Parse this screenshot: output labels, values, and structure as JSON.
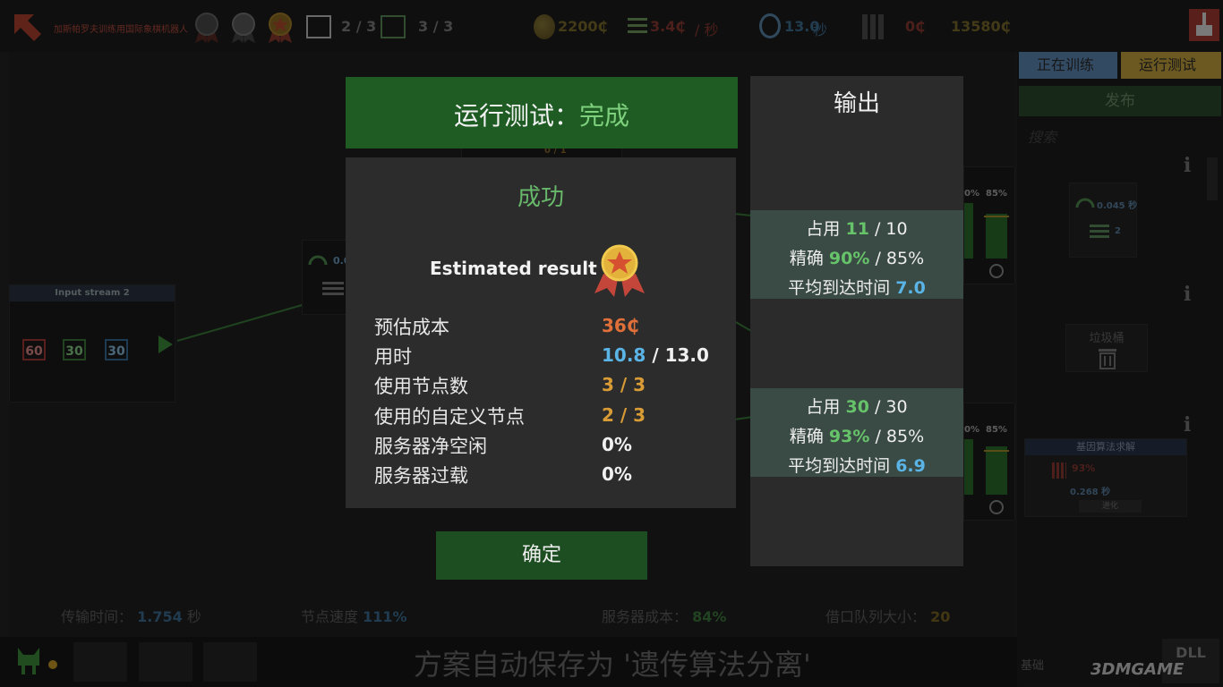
{
  "topbar": {
    "level_name": "加斯帕罗夫训练用国际象棋机器人",
    "medals": [
      "bronze-medal-icon",
      "silver-medal-icon",
      "gold-medal-icon"
    ],
    "nodes_used": "2 / 3",
    "custom_nodes": "3 / 3",
    "budget": "2200₵",
    "rate_value": "3.4₵",
    "rate_unit": "/ 秒",
    "time_value": "13.0",
    "time_unit": "秒",
    "balance": "0₵",
    "credits": "13580₵"
  },
  "workspace": {
    "input_stream_title": "Input stream 2",
    "input_values": [
      {
        "value": "60",
        "color": "#a03a33"
      },
      {
        "value": "30",
        "color": "#3f7a3a"
      },
      {
        "value": "30",
        "color": "#356d9a"
      }
    ],
    "node_label_fragment": "0.0",
    "node_counter_fragment": "0 / 1",
    "right_node_pct_top": "85%",
    "right_node_pct_bottom": "85%",
    "right_node_small_top": "0%",
    "right_node_small_bottom": "0%"
  },
  "status": {
    "transfer_label": "传输时间：",
    "transfer_value": "1.754",
    "transfer_unit": "秒",
    "node_speed_label": "节点速度",
    "node_speed_value": "111%",
    "server_cost_label": "服务器成本：",
    "server_cost_value": "84%",
    "queue_label": "借口队列大小：",
    "queue_value": "20"
  },
  "autosave_text": "方案自动保存为 '遗传算法分离'",
  "right_panel": {
    "tab_training": "正在训练",
    "tab_run_test": "运行测试",
    "publish": "发布",
    "search_placeholder": "搜索",
    "speed_value": "0.045 秒",
    "count_value": "2",
    "trash_label": "垃圾桶",
    "ga_title": "基因算法求解",
    "ga_accuracy": "93%",
    "ga_speed": "0.268 秒",
    "ga_evolve": "进化",
    "bottom_label": "基础",
    "dll_label": "DLL",
    "watermark": "3DMGAME"
  },
  "modal": {
    "title_prefix": "运行测试：",
    "title_state": "完成",
    "success": "成功",
    "estimated_result": "Estimated result",
    "rows": [
      {
        "label": "预估成本",
        "value": "36₵",
        "suffix": ""
      },
      {
        "label": "用时",
        "value": "10.8",
        "suffix": " / 13.0"
      },
      {
        "label": "使用节点数",
        "value": "3 / 3",
        "suffix": ""
      },
      {
        "label": "使用的自定义节点",
        "value": "2 / 3",
        "suffix": ""
      },
      {
        "label": "服务器净空闲",
        "value": "0%",
        "suffix": ""
      },
      {
        "label": "服务器过载",
        "value": "0%",
        "suffix": ""
      }
    ],
    "ok_button": "确定"
  },
  "output": {
    "title": "输出",
    "cards": [
      {
        "occupy_label": "占用",
        "occupy_value": "11",
        "occupy_max": " / 10",
        "acc_label": "精确",
        "acc_value": "90%",
        "acc_target": " / 85%",
        "arrival_label": "平均到达时间",
        "arrival_value": "7.0"
      },
      {
        "occupy_label": "占用",
        "occupy_value": "30",
        "occupy_max": " / 30",
        "acc_label": "精确",
        "acc_value": "93%",
        "acc_target": " / 85%",
        "arrival_label": "平均到达时间",
        "arrival_value": "6.9"
      }
    ]
  },
  "colors": {
    "accent_green": "#1e5c24",
    "success_green": "#67b86a",
    "value_blue": "#5ab4e6",
    "value_orange": "#d89b35"
  }
}
